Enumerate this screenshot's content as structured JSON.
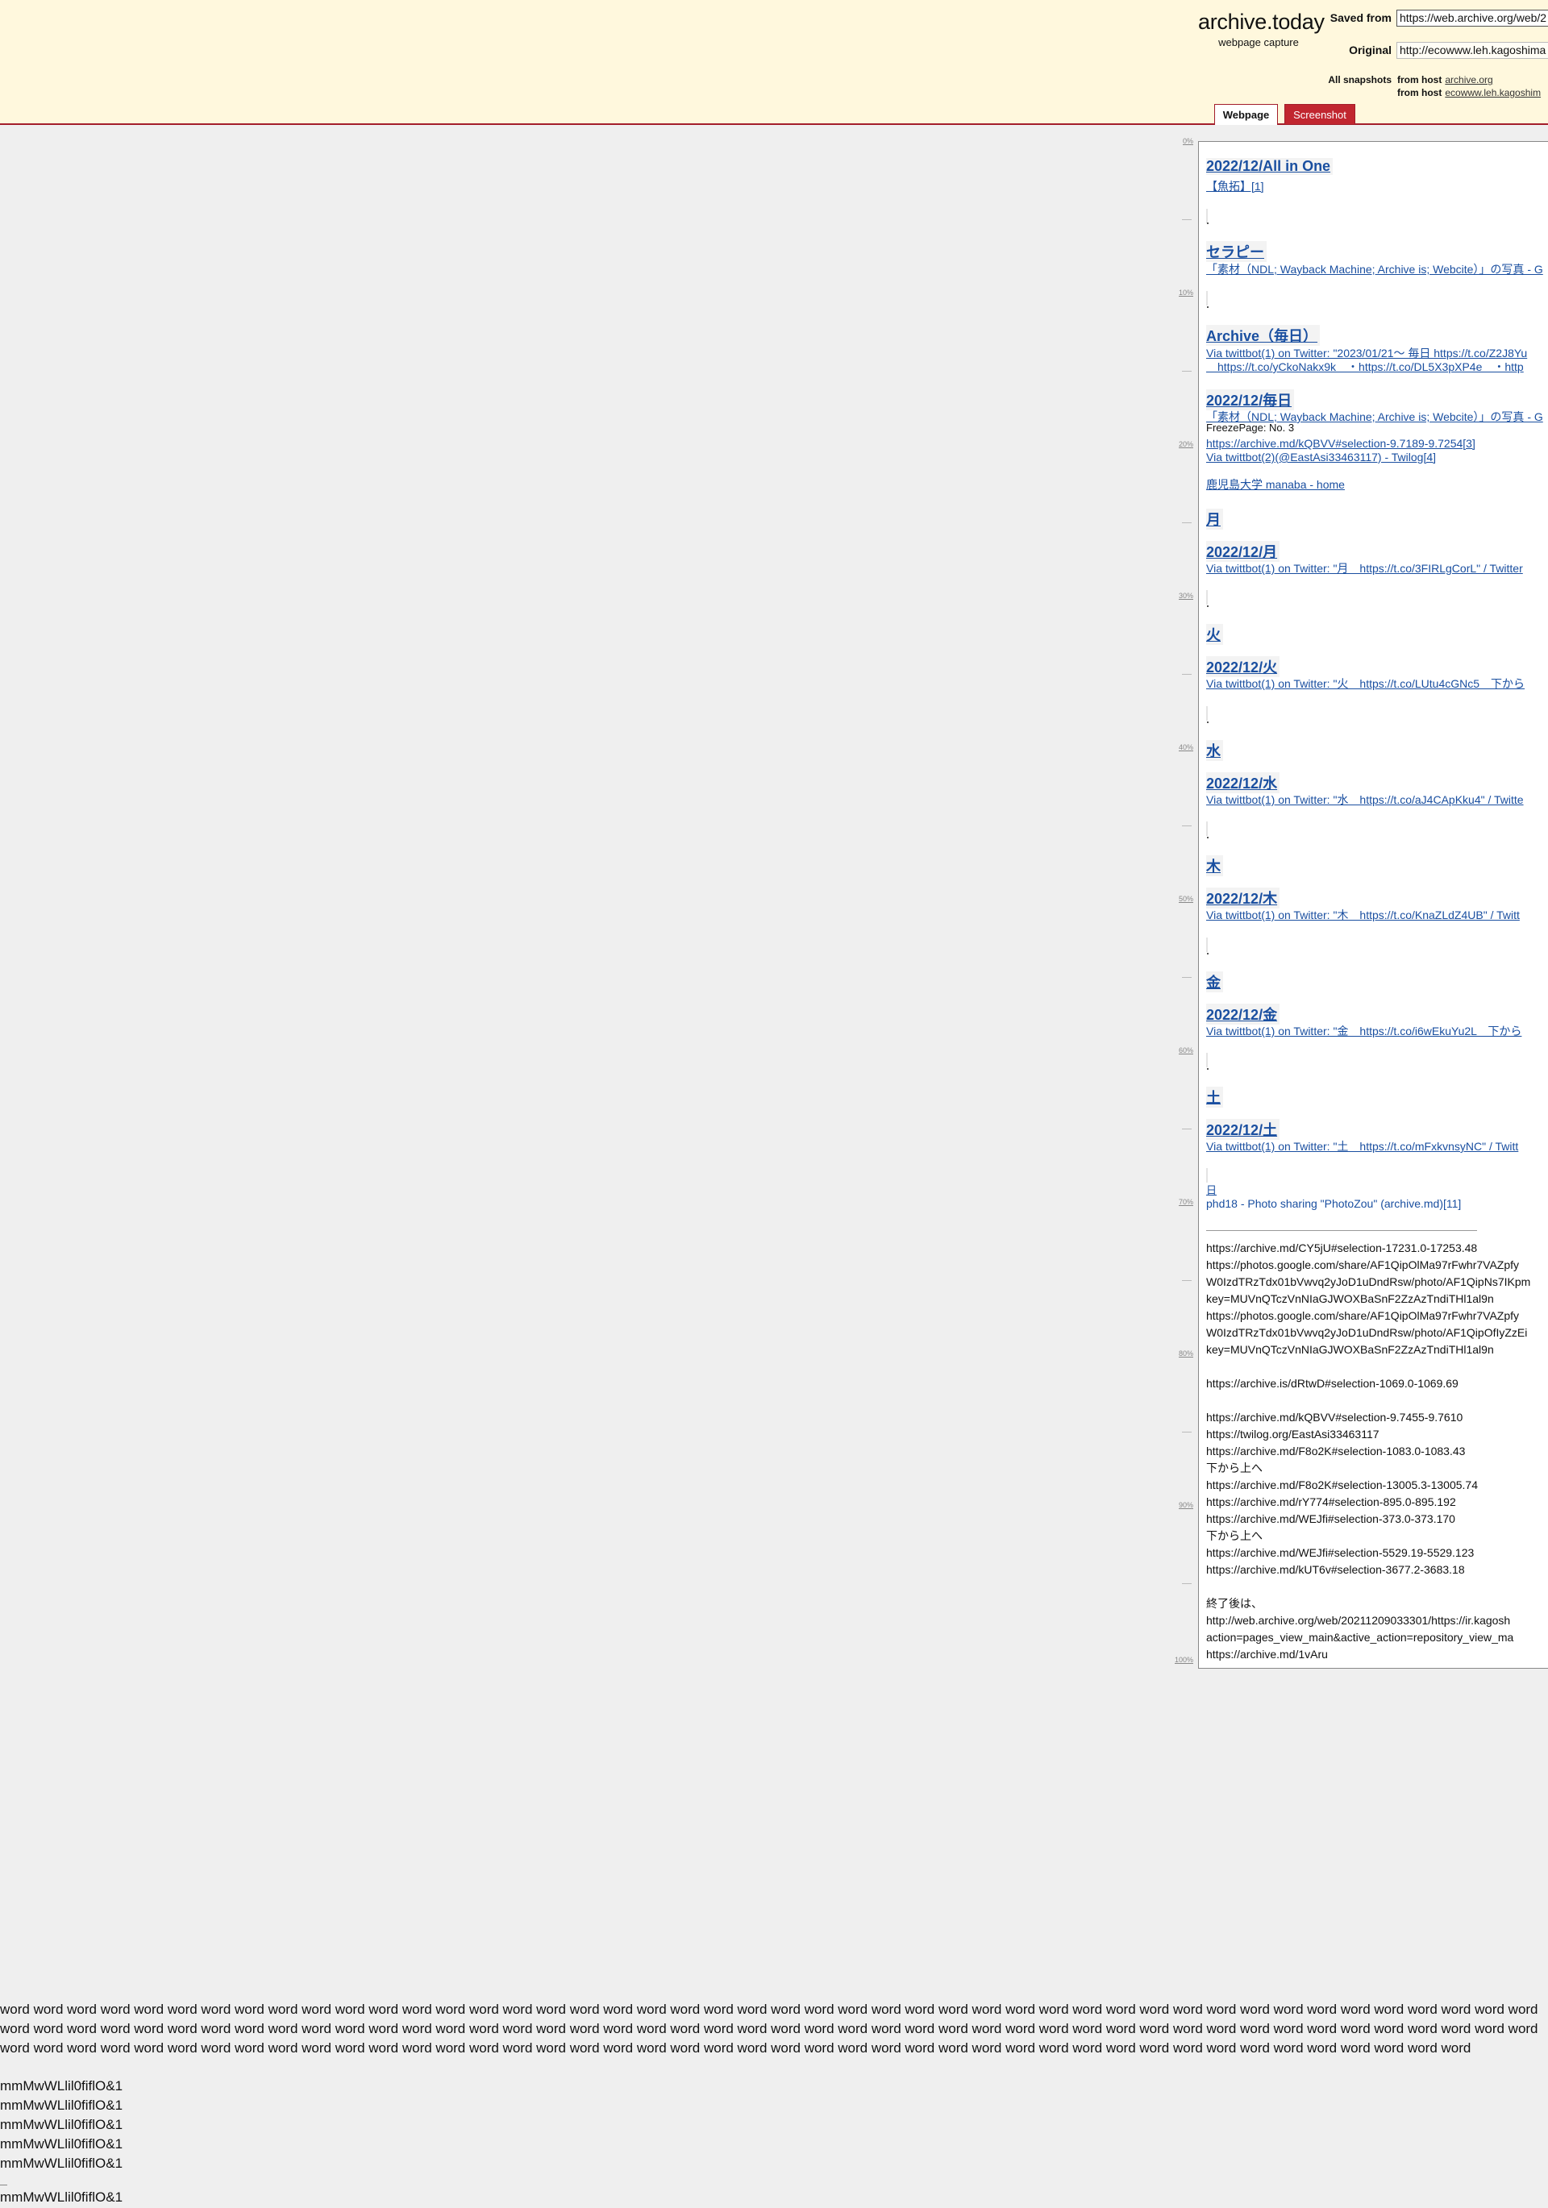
{
  "header": {
    "brand_title": "archive.today",
    "brand_subtitle": "webpage capture",
    "saved_from_label": "Saved from",
    "saved_from_value": "https://web.archive.org/web/2",
    "original_label": "Original",
    "original_value": "http://ecowww.leh.kagoshima",
    "all_snapshots_label": "All snapshots",
    "from_host_label": "from host",
    "host_1": "archive.org",
    "host_2": "ecowww.leh.kagoshim",
    "tab_webpage": "Webpage",
    "tab_screenshot": "Screenshot"
  },
  "ruler": [
    "0%",
    "10%",
    "20%",
    "30%",
    "40%",
    "50%",
    "60%",
    "70%",
    "80%",
    "90%",
    "100%"
  ],
  "content": {
    "h_allinone": "2022/12/All in One",
    "l_gyotaku": "【魚拓】[1]",
    "h_therapy": "セラピー",
    "l_therapy": "「素材（NDL; Wayback Machine; Archive is; Webcite）」の写真 - G",
    "h_archive": "Archive（毎日）",
    "l_archive_1": "Via twittbot(1) on Twitter: \"2023/01/21〜 毎日 https://t.co/Z2J8Yu",
    "l_archive_2": "　https://t.co/yCkoNakx9k　・https://t.co/DL5X3pXP4e　・http",
    "h_daily": "2022/12/毎日",
    "l_daily_1": "「素材（NDL; Wayback Machine; Archive is; Webcite）」の写真 - G",
    "p_freeze": "FreezePage: No. 3",
    "l_daily_2": "https://archive.md/kQBVV#selection-9.7189-9.7254[3]",
    "l_daily_3": "Via twittbot(2)(@EastAsi33463117) - Twilog[4]",
    "l_manaba": "鹿児島大学 manaba - home",
    "h_mon": "月",
    "h_mon_date": "2022/12/月",
    "l_mon": "Via twittbot(1) on Twitter: \"月　https://t.co/3FIRLgCorL\" / Twitter",
    "h_tue": "火",
    "h_tue_date": "2022/12/火",
    "l_tue": "Via twittbot(1) on Twitter: \"火　https://t.co/LUtu4cGNc5　下から",
    "h_wed": "水",
    "h_wed_date": "2022/12/水",
    "l_wed": "Via twittbot(1) on Twitter: \"水　https://t.co/aJ4CApKku4\" / Twitte",
    "h_thu": "木",
    "h_thu_date": "2022/12/木",
    "l_thu": "Via twittbot(1) on Twitter: \"木　https://t.co/KnaZLdZ4UB\" / Twitt",
    "h_fri": "金",
    "h_fri_date": "2022/12/金",
    "l_fri": "Via twittbot(1) on Twitter: \"金　https://t.co/i6wEkuYu2L　下から",
    "h_sat": "土",
    "h_sat_date": "2022/12/土",
    "l_sat": "Via twittbot(1) on Twitter: \"土　https://t.co/mFxkvnsyNC\" / Twitt",
    "l_sun": "日",
    "l_phd": "phd18 - Photo sharing \"PhotoZou\" (archive.md)",
    "l_phd_ref": "[11]",
    "refs": [
      "https://archive.md/CY5jU#selection-17231.0-17253.48",
      "https://photos.google.com/share/AF1QipOlMa97rFwhr7VAZpfy",
      "W0IzdTRzTdx01bVwvq2yJoD1uDndRsw/photo/AF1QipNs7IKpm",
      "key=MUVnQTczVnNIaGJWOXBaSnF2ZzAzTndiTHl1al9n",
      "https://photos.google.com/share/AF1QipOlMa97rFwhr7VAZpfy",
      "W0IzdTRzTdx01bVwvq2yJoD1uDndRsw/photo/AF1QipOfIyZzEi",
      "key=MUVnQTczVnNIaGJWOXBaSnF2ZzAzTndiTHl1al9n",
      "https://archive.is/dRtwD#selection-1069.0-1069.69",
      "https://archive.md/kQBVV#selection-9.7455-9.7610",
      "https://twilog.org/EastAsi33463117",
      "https://archive.md/F8o2K#selection-1083.0-1083.43",
      "下から上へ",
      "https://archive.md/F8o2K#selection-13005.3-13005.74",
      "https://archive.md/rY774#selection-895.0-895.192",
      "https://archive.md/WEJfi#selection-373.0-373.170",
      "下から上へ",
      "https://archive.md/WEJfi#selection-5529.19-5529.123",
      "https://archive.md/kUT6v#selection-3677.2-3683.18",
      "終了後は、",
      "http://web.archive.org/web/20211209033301/https://ir.kagosh",
      "action=pages_view_main&active_action=repository_view_ma",
      "https://archive.md/1vAru"
    ]
  },
  "footer": {
    "words": "word word word word word word word word word word word word word word word word word word word word word word word word word word word word word word word word word word word word word word word word word word word word word word word word word word word word word word word word word word word word word word word word word word word word word word word word word word word word word word word word word word word word word word word word word word word word word word word word word word word word word word word word word word word word word word word word word word word word word word word word word word word word word word word word word word word word word word word word",
    "mm_lines": [
      "mmMwWLlil0fiflO&1",
      "mmMwWLlil0fiflO&1",
      "mmMwWLlil0fiflO&1",
      "mmMwWLlil0fiflO&1",
      "mmMwWLlil0fiflO&1",
      "mmMwWLlil0fiflO&1"
    ]
  }
}
